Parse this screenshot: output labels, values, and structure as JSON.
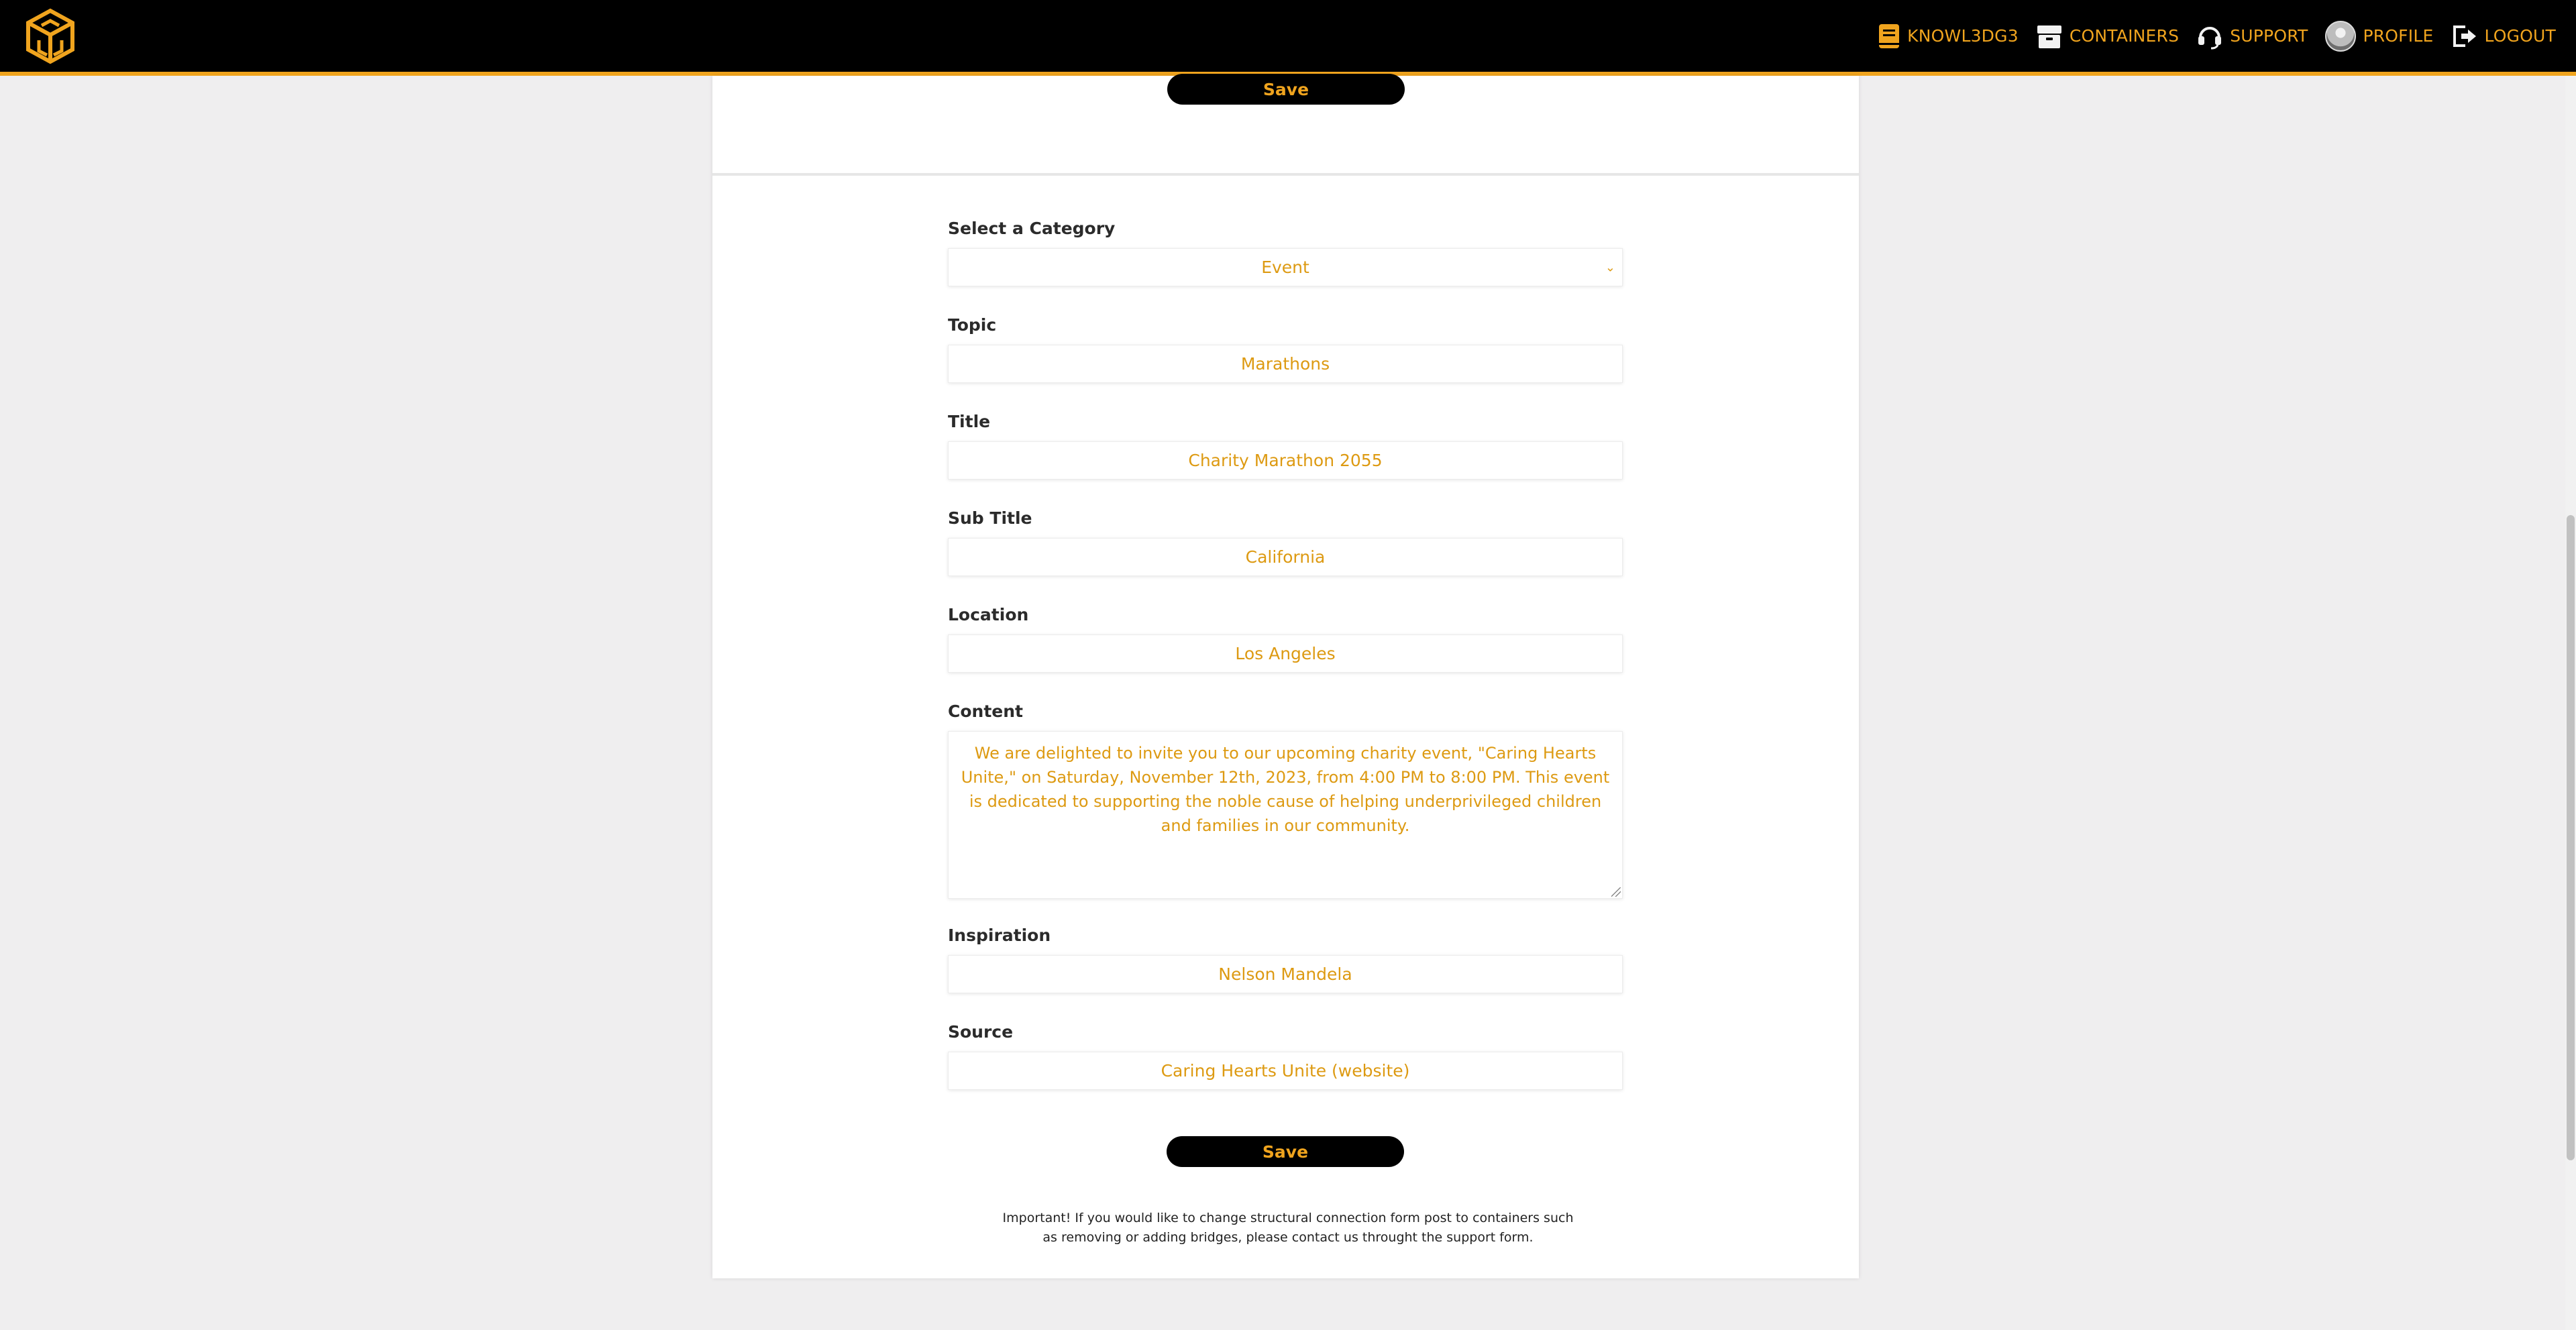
{
  "nav": {
    "items": [
      {
        "label": "KNOWL3DG3",
        "icon": "book-icon"
      },
      {
        "label": "CONTAINERS",
        "icon": "box-icon"
      },
      {
        "label": "SUPPORT",
        "icon": "headset-icon"
      },
      {
        "label": "PROFILE",
        "icon": "avatar"
      },
      {
        "label": "LOGOUT",
        "icon": "logout-icon"
      }
    ]
  },
  "top_save_label": "Save",
  "form": {
    "category": {
      "label": "Select a Category",
      "value": "Event"
    },
    "topic": {
      "label": "Topic",
      "value": "Marathons"
    },
    "title": {
      "label": "Title",
      "value": "Charity Marathon 2055"
    },
    "subtitle": {
      "label": "Sub Title",
      "value": "California"
    },
    "location": {
      "label": "Location",
      "value": "Los Angeles"
    },
    "content": {
      "label": "Content",
      "value": "We are delighted to invite you to our upcoming charity event, \"Caring Hearts Unite,\" on Saturday, November 12th, 2023, from 4:00 PM to 8:00 PM. This event is dedicated to supporting the noble cause of helping underprivileged children and families in our community."
    },
    "inspiration": {
      "label": "Inspiration",
      "value": "Nelson Mandela"
    },
    "source": {
      "label": "Source",
      "value": "Caring Hearts Unite (website)"
    },
    "save_label": "Save"
  },
  "note": {
    "line1": "Important! If you would like to change structural connection form post to containers such",
    "line2": "as removing or adding bridges, please contact us throught the support form."
  },
  "colors": {
    "accent": "#f0a41e",
    "field_text": "#dd9a12",
    "topbar": "#000000"
  }
}
